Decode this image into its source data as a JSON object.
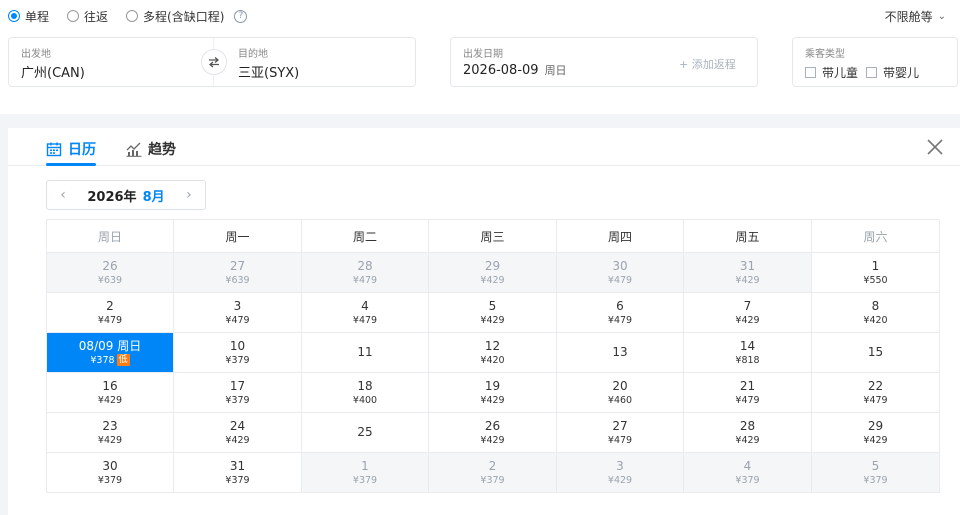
{
  "trip_types": [
    {
      "label": "单程",
      "selected": true
    },
    {
      "label": "往返",
      "selected": false
    },
    {
      "label": "多程(含缺口程)",
      "selected": false
    }
  ],
  "cabin_label": "不限舱等",
  "departure": {
    "label": "出发地",
    "value": "广州(CAN)"
  },
  "arrival": {
    "label": "目的地",
    "value": "三亚(SYX)"
  },
  "date": {
    "label": "出发日期",
    "value": "2026-08-09",
    "weekday": "周日",
    "add_return": "+ 添加返程"
  },
  "passenger": {
    "label": "乘客类型",
    "child": "带儿童",
    "infant": "带婴儿"
  },
  "tabs": {
    "calendar": "日历",
    "trend": "趋势"
  },
  "month_nav": {
    "year": "2026年",
    "month": "8月"
  },
  "weekdays": [
    "周日",
    "周一",
    "周二",
    "周三",
    "周四",
    "周五",
    "周六"
  ],
  "days": [
    {
      "d": "26",
      "p": "¥639",
      "out": true
    },
    {
      "d": "27",
      "p": "¥639",
      "out": true
    },
    {
      "d": "28",
      "p": "¥479",
      "out": true
    },
    {
      "d": "29",
      "p": "¥429",
      "out": true
    },
    {
      "d": "30",
      "p": "¥479",
      "out": true
    },
    {
      "d": "31",
      "p": "¥429",
      "out": true
    },
    {
      "d": "1",
      "p": "¥550"
    },
    {
      "d": "2",
      "p": "¥479"
    },
    {
      "d": "3",
      "p": "¥479"
    },
    {
      "d": "4",
      "p": "¥479"
    },
    {
      "d": "5",
      "p": "¥429"
    },
    {
      "d": "6",
      "p": "¥479"
    },
    {
      "d": "7",
      "p": "¥429"
    },
    {
      "d": "8",
      "p": "¥420"
    },
    {
      "d": "08/09 周日",
      "p": "¥378",
      "selected": true,
      "badge": "低"
    },
    {
      "d": "10",
      "p": "¥379"
    },
    {
      "d": "11",
      "p": ""
    },
    {
      "d": "12",
      "p": "¥420"
    },
    {
      "d": "13",
      "p": ""
    },
    {
      "d": "14",
      "p": "¥818"
    },
    {
      "d": "15",
      "p": ""
    },
    {
      "d": "16",
      "p": "¥429"
    },
    {
      "d": "17",
      "p": "¥379"
    },
    {
      "d": "18",
      "p": "¥400"
    },
    {
      "d": "19",
      "p": "¥429"
    },
    {
      "d": "20",
      "p": "¥460"
    },
    {
      "d": "21",
      "p": "¥479"
    },
    {
      "d": "22",
      "p": "¥479"
    },
    {
      "d": "23",
      "p": "¥429"
    },
    {
      "d": "24",
      "p": "¥429"
    },
    {
      "d": "25",
      "p": ""
    },
    {
      "d": "26",
      "p": "¥429"
    },
    {
      "d": "27",
      "p": "¥479"
    },
    {
      "d": "28",
      "p": "¥429"
    },
    {
      "d": "29",
      "p": "¥429"
    },
    {
      "d": "30",
      "p": "¥379"
    },
    {
      "d": "31",
      "p": "¥379"
    },
    {
      "d": "1",
      "p": "¥379",
      "out": true
    },
    {
      "d": "2",
      "p": "¥379",
      "out": true
    },
    {
      "d": "3",
      "p": "¥429",
      "out": true
    },
    {
      "d": "4",
      "p": "¥379",
      "out": true
    },
    {
      "d": "5",
      "p": "¥379",
      "out": true
    }
  ],
  "colors": {
    "accent": "#0086f6",
    "low_badge": "#ff7d13",
    "out_of_month_bg": "#f5f6f8"
  }
}
